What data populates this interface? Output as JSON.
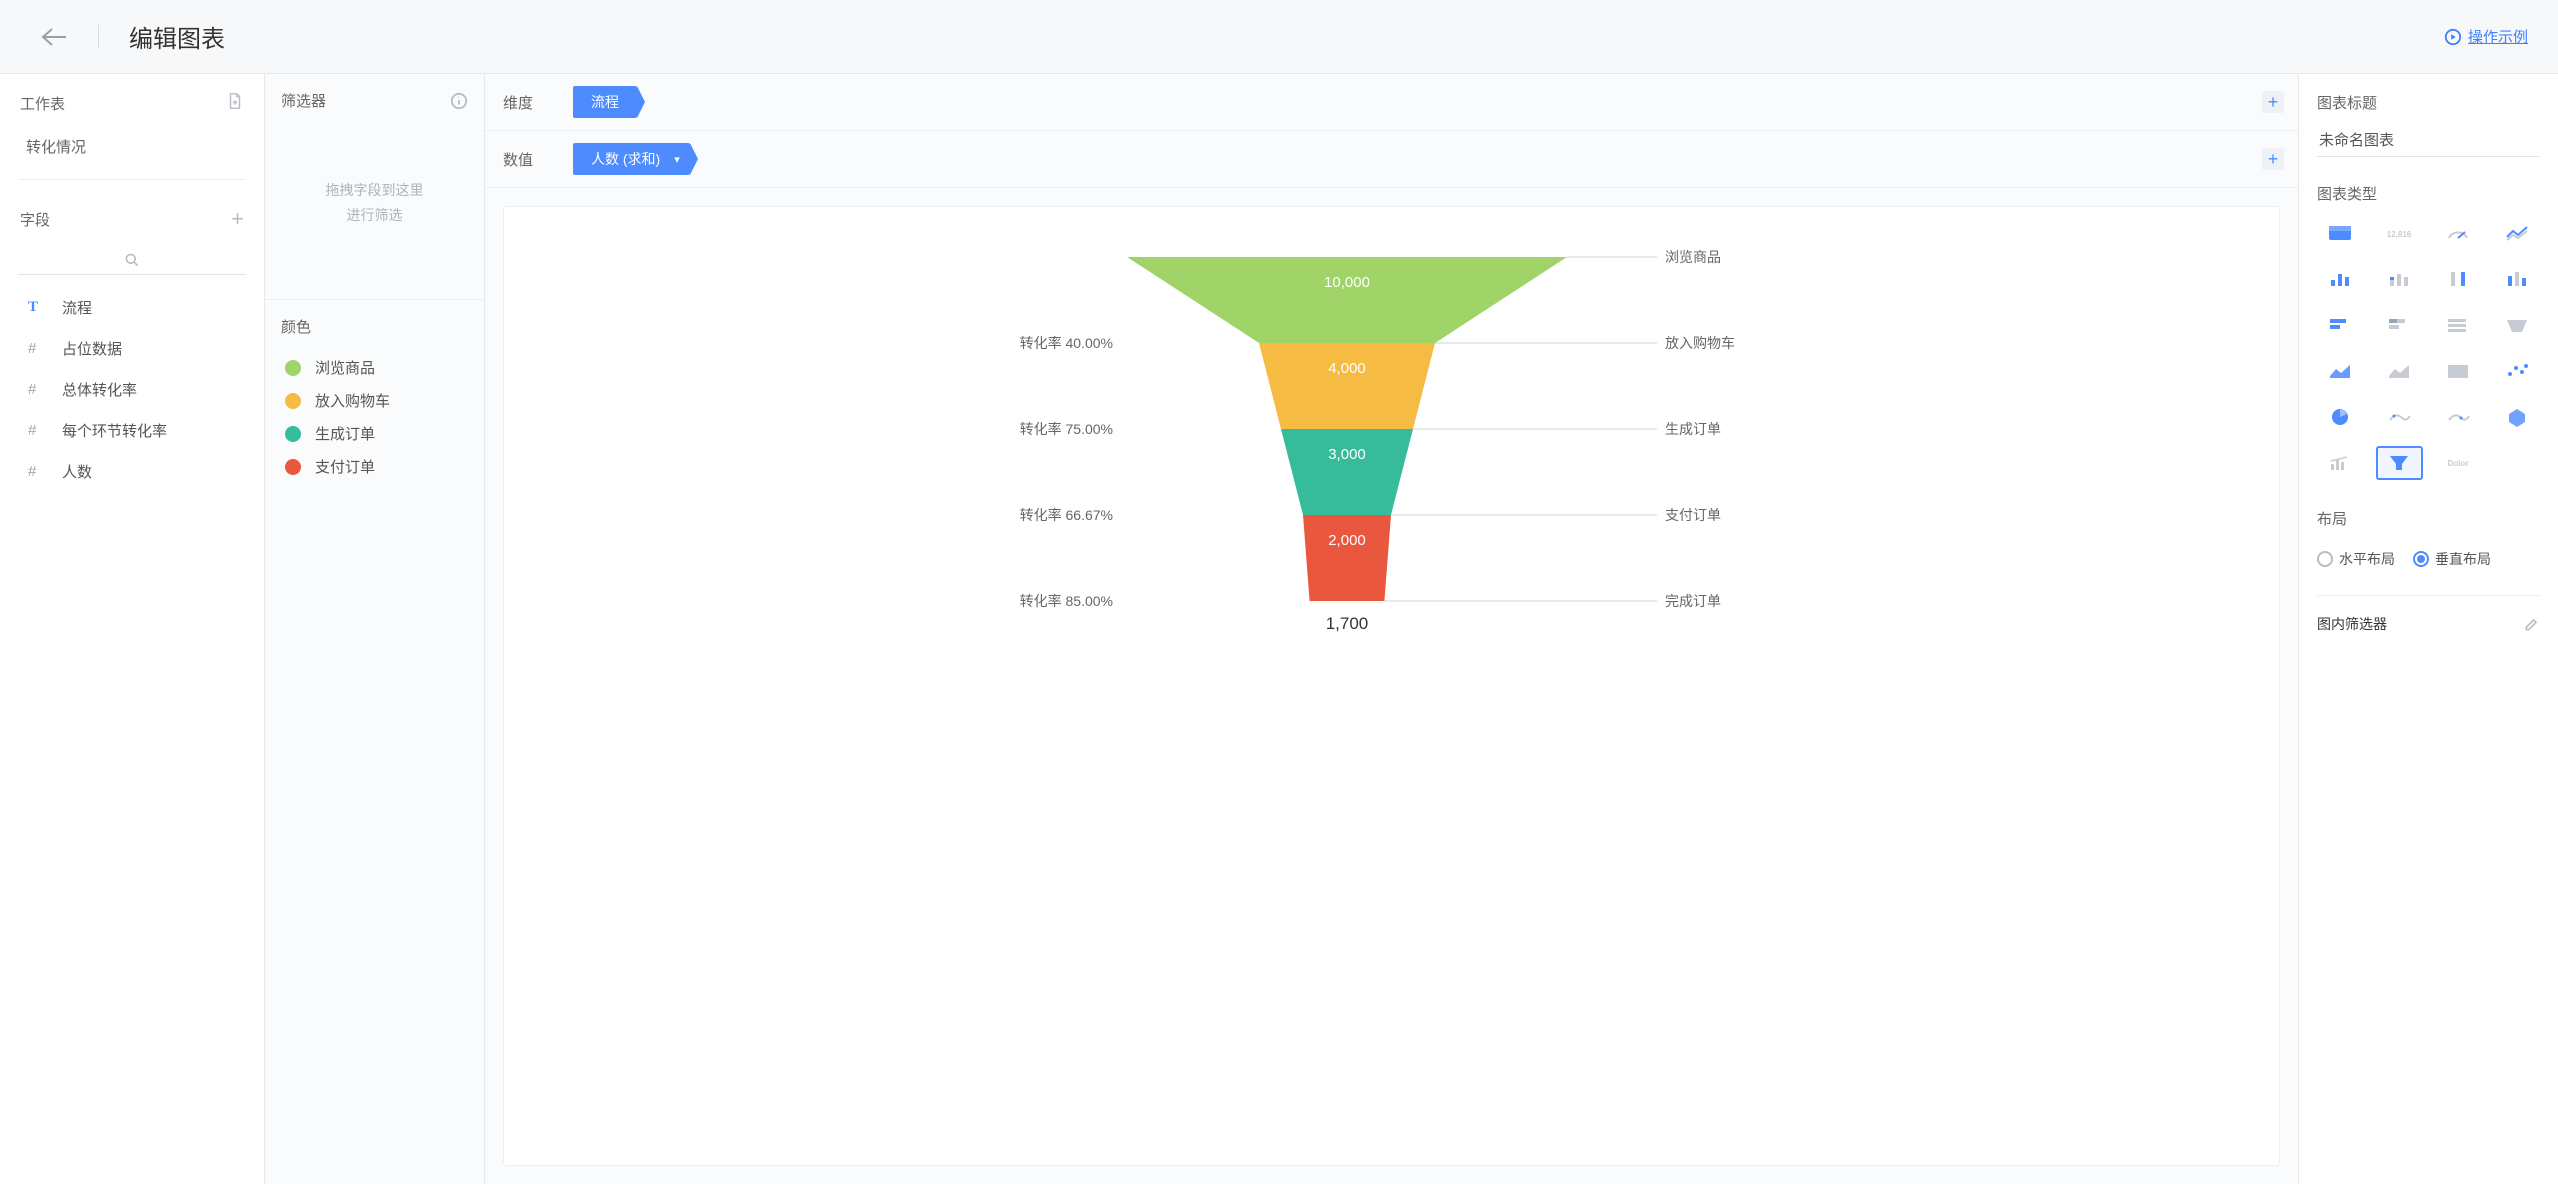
{
  "header": {
    "title": "编辑图表",
    "example_link": "操作示例"
  },
  "sidebar": {
    "worksheet_label": "工作表",
    "worksheets": [
      "转化情况"
    ],
    "fields_label": "字段",
    "fields": [
      {
        "type": "T",
        "name": "流程"
      },
      {
        "type": "#",
        "name": "占位数据"
      },
      {
        "type": "#",
        "name": "总体转化率"
      },
      {
        "type": "#",
        "name": "每个环节转化率"
      },
      {
        "type": "#",
        "name": "人数"
      }
    ]
  },
  "config": {
    "dimension_label": "维度",
    "dimension_pill": "流程",
    "value_label": "数值",
    "value_pill": "人数 (求和)",
    "filter_label": "筛选器",
    "filter_placeholder_l1": "拖拽字段到这里",
    "filter_placeholder_l2": "进行筛选",
    "color_label": "颜色",
    "legend": [
      {
        "label": "浏览商品",
        "color": "#a0d468"
      },
      {
        "label": "放入购物车",
        "color": "#f6bb42"
      },
      {
        "label": "生成订单",
        "color": "#37bc9b"
      },
      {
        "label": "支付订单",
        "color": "#e9573f"
      }
    ]
  },
  "right": {
    "title_label": "图表标题",
    "title_value": "未命名图表",
    "type_label": "图表类型",
    "layout_label": "布局",
    "layout_h": "水平布局",
    "layout_v": "垂直布局",
    "layout_selected": "v",
    "infilter_label": "图内筛选器"
  },
  "chart_data": {
    "type": "funnel",
    "rate_prefix": "转化率",
    "stages": [
      {
        "label": "浏览商品",
        "value": 10000,
        "display": "10,000",
        "color": "#a0d468"
      },
      {
        "label": "放入购物车",
        "value": 4000,
        "display": "4,000",
        "color": "#f6bb42",
        "rate_from_prev": 40.0,
        "rate_display": "40.00%"
      },
      {
        "label": "生成订单",
        "value": 3000,
        "display": "3,000",
        "color": "#37bc9b",
        "rate_from_prev": 75.0,
        "rate_display": "75.00%"
      },
      {
        "label": "支付订单",
        "value": 2000,
        "display": "2,000",
        "color": "#e9573f",
        "rate_from_prev": 66.67,
        "rate_display": "66.67%"
      },
      {
        "label": "完成订单",
        "value": 1700,
        "display": "1,700",
        "rate_from_prev": 85.0,
        "rate_display": "85.00%"
      }
    ]
  }
}
